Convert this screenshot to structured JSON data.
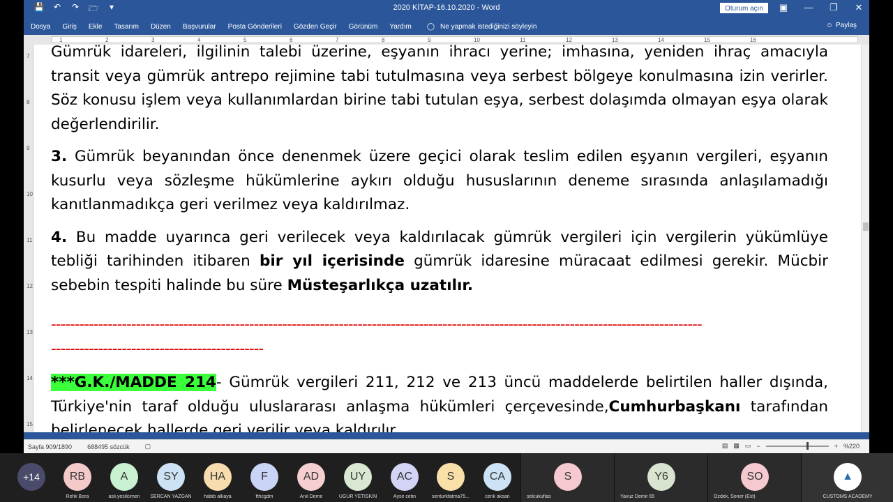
{
  "window": {
    "title": "2020 KİTAP-16.10.2020  -  Word",
    "signin": "Oturum açın",
    "qat_icons": [
      "save-icon",
      "undo-icon",
      "redo-icon",
      "open-folder-icon",
      "customize-icon"
    ]
  },
  "ribbon": {
    "tabs": [
      "Dosya",
      "Giriş",
      "Ekle",
      "Tasarım",
      "Düzen",
      "Başvurular",
      "Posta Gönderileri",
      "Gözden Geçir",
      "Görünüm",
      "Yardım"
    ],
    "tell_me": "Ne yapmak istediğinizi söyleyin",
    "share": "Paylaş"
  },
  "ruler": {
    "h_numbers": [
      "1",
      "2",
      "3",
      "4",
      "5",
      "6",
      "7",
      "8",
      "9",
      "10",
      "11",
      "12",
      "13",
      "14",
      "15",
      "16"
    ],
    "v_numbers": [
      "7",
      "8",
      "9",
      "10",
      "11",
      "12",
      "13",
      "14",
      "15"
    ]
  },
  "document": {
    "p1": "Gümrük idareleri, ilgilinin talebi üzerine, eşyanın ihracı yerine; imhasına, yeniden ihraç amacıyla transit veya gümrük antrepo rejimine tabi tutulmasına veya serbest bölgeye konulmasına izin verirler. Söz konusu işlem veya kullanımlardan birine tabi tutulan eşya, serbest dolaşımda olmayan eşya olarak değerlendirilir.",
    "p2_num": "3.",
    "p2": " Gümrük beyanından önce denenmek üzere geçici olarak teslim edilen eşyanın vergileri, eşyanın kusurlu veya sözleşme hükümlerine aykırı olduğu hususlarının deneme sırasında anlaşılamadığı kanıtlanmadıkça geri verilmez veya kaldırılmaz.",
    "p3_num": "4.",
    "p3_a": " Bu madde uyarınca geri verilecek veya kaldırılacak gümrük vergileri için vergilerin yükümlüye tebliği tarihinden itibaren ",
    "p3_b": "bir yıl içerisinde",
    "p3_c": " gümrük idaresine müracaat edilmesi gerekir. Mücbir sebebin tespiti halinde bu süre ",
    "p3_d": "Müsteşarlıkça uzatılır.",
    "dashes_1": "------------------------------------------------------------------------------------------------------------------------------------------",
    "dashes_2": "---------------------------------------------",
    "p4_tag": "***G.K./MADDE 214",
    "p4_a": "- Gümrük vergileri 211, 212 ve 213 üncü maddelerde belirtilen haller dışında, Türkiye'nin taraf olduğu uluslararası anlaşma hükümleri çerçevesinde,",
    "p4_b": "Cumhurbaşkanı",
    "p4_c": " tarafından belirlenecek hallerde geri verilir veya kaldırılır."
  },
  "status": {
    "page": "Sayfa 909/1890",
    "words": "688495 sözcük",
    "zoom": "%220"
  },
  "participants": {
    "more": "+14",
    "people": [
      {
        "initials": "RB",
        "name": "Refik Bora",
        "color": "#f4c9c9"
      },
      {
        "initials": "A",
        "name": "asli.yesilcimen",
        "color": "#c9f0d0"
      },
      {
        "initials": "SY",
        "name": "SERCAN YAZGAN",
        "color": "#cde3f5"
      },
      {
        "initials": "HA",
        "name": "habib alkaya",
        "color": "#f7dcae"
      },
      {
        "initials": "F",
        "name": "fthcgdm",
        "color": "#c9d4f7"
      },
      {
        "initials": "AD",
        "name": "Anıl Demir",
        "color": "#f5cfd0"
      },
      {
        "initials": "UY",
        "name": "UGUR YETISKIN",
        "color": "#d9e8d2"
      },
      {
        "initials": "AC",
        "name": "Ayse cetin",
        "color": "#d3d4f5"
      },
      {
        "initials": "S",
        "name": "senturkfatma75...",
        "color": "#f9e0a8"
      },
      {
        "initials": "CA",
        "name": "cenk aksan",
        "color": "#cde3f5"
      }
    ],
    "tiles": [
      {
        "initials": "S",
        "name": "selcukuflas",
        "color": "#f5c9cf"
      },
      {
        "initials": "Y6",
        "name": "Yavuz Demir 65",
        "color": "#d8e4cf"
      },
      {
        "initials": "SO",
        "name": "Ozdek, Soner (Ext)",
        "color": "#f5c9cf"
      },
      {
        "initials": "",
        "name": "CUSTOMS ACADEMY",
        "color": "#ffffff"
      }
    ]
  }
}
